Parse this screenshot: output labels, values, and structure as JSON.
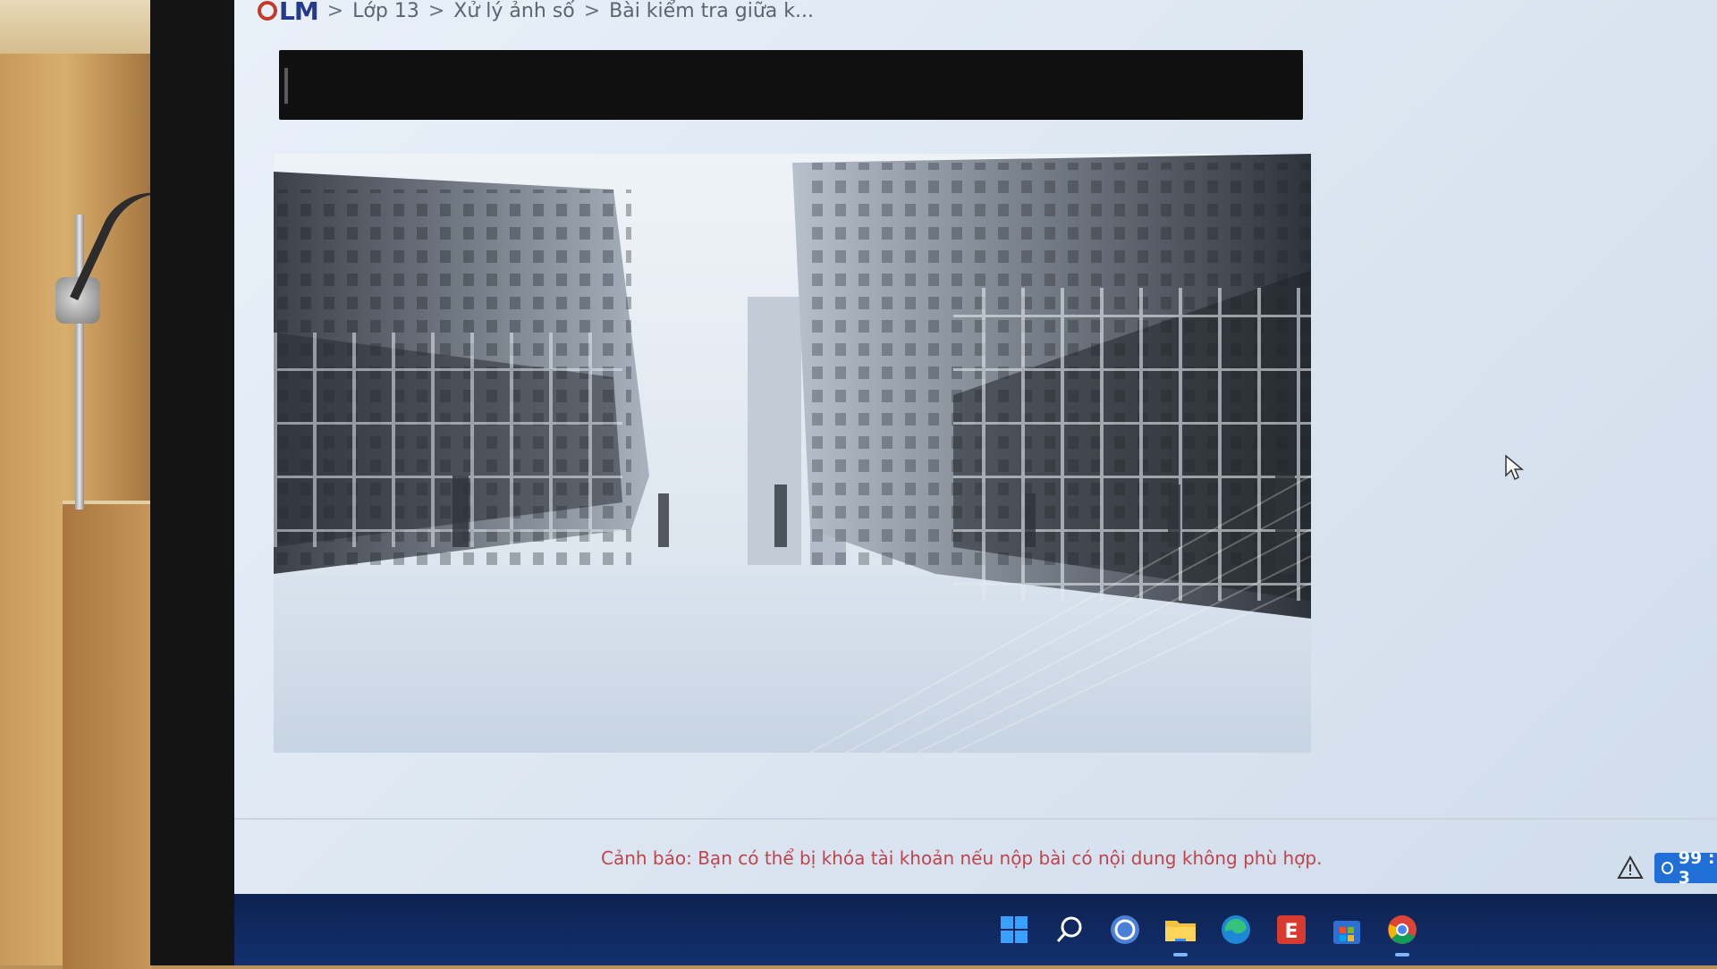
{
  "breadcrumb": {
    "logo": "LM",
    "items": [
      "Lớp 13",
      "Xử lý ảnh số",
      "Bài kiểm tra giữa k..."
    ],
    "separator": ">"
  },
  "footer": {
    "warning": "Cảnh báo: Bạn có thể bị khóa tài khoản nếu nộp bài có nội dung không phù hợp.",
    "timer": "99 : 3"
  },
  "taskbar": {
    "icons": [
      "windows-start-icon",
      "search-icon",
      "teams-icon",
      "file-explorer-icon",
      "edge-icon",
      "app-e-icon",
      "store-icon",
      "chrome-icon"
    ]
  },
  "colors": {
    "logo": "#243a8c",
    "logo_ring": "#c43a2b",
    "warning_text": "#c0444c",
    "timer_bg": "#1f6fd6",
    "taskbar": "#13306e"
  }
}
